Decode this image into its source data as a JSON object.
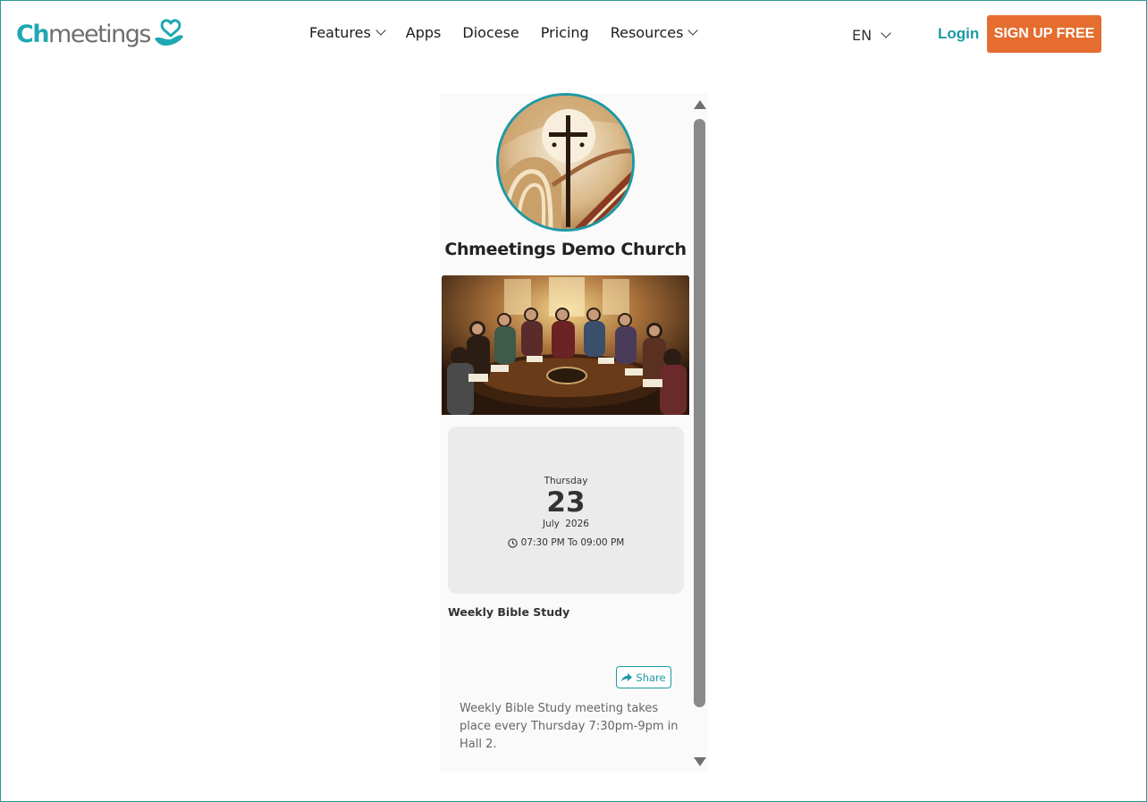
{
  "header": {
    "logo": {
      "part1": "Ch",
      "part2": "meetings",
      "icon": "heart-hand-icon"
    },
    "nav": [
      {
        "label": "Features",
        "dropdown": true
      },
      {
        "label": "Apps",
        "dropdown": false
      },
      {
        "label": "Diocese",
        "dropdown": false
      },
      {
        "label": "Pricing",
        "dropdown": false
      },
      {
        "label": "Resources",
        "dropdown": true
      }
    ],
    "language": "EN",
    "login_label": "Login",
    "signup_label": "SIGN UP FREE"
  },
  "church": {
    "name": "Chmeetings Demo Church",
    "logo_icon": "cross-emblem-icon"
  },
  "event": {
    "day_name": "Thursday",
    "day_number": "23",
    "month": "July",
    "year": "2026",
    "time_range": "07:30 PM To 09:00 PM",
    "title": "Weekly Bible Study",
    "share_label": "Share",
    "description": "Weekly Bible Study meeting takes place every Thursday 7:30pm-9pm in Hall 2."
  },
  "colors": {
    "brand_teal": "#1fa8b3",
    "signup_orange": "#e56d2f",
    "date_card_bg": "#ebebeb"
  }
}
